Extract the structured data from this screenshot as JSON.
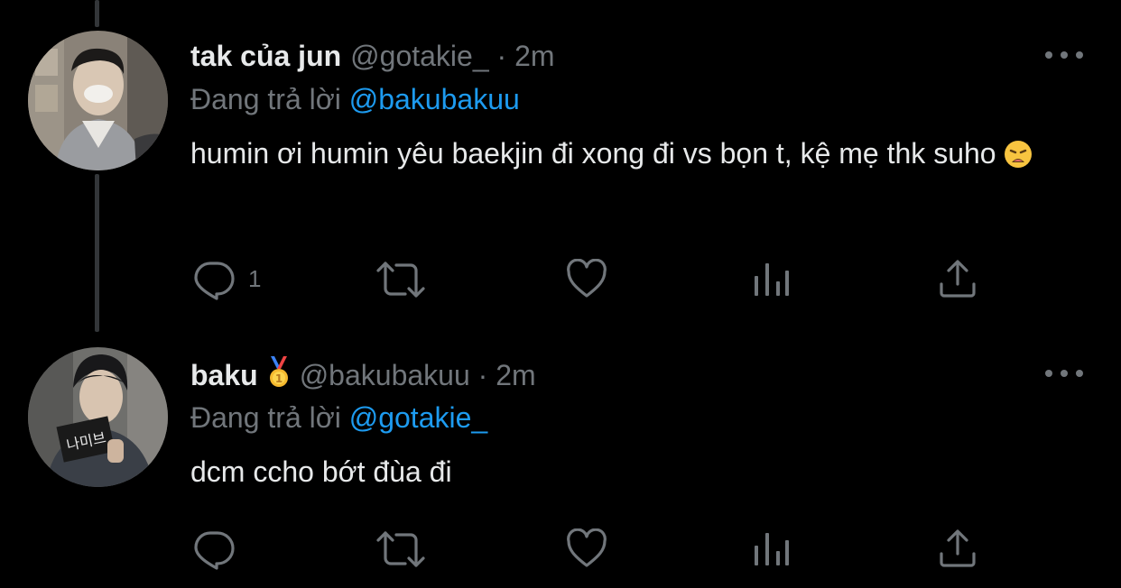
{
  "colors": {
    "background": "#000000",
    "text": "#e7e9ea",
    "muted": "#71767b",
    "link": "#1d9bf0",
    "thread_line": "#333639"
  },
  "tweets": [
    {
      "name": "tak của jun",
      "handle": "@gotakie_",
      "separator": "·",
      "time": "2m",
      "reply_prefix": "Đang trả lời",
      "reply_to": "@bakubakuu",
      "text": "humin ơi humin yêu baekjin đi xong đi vs bọn t, kệ mẹ thk suho",
      "emoji": "weary-face-emoji",
      "actions": {
        "reply_count": "1",
        "retweet_count": "",
        "like_count": ""
      }
    },
    {
      "name": "baku",
      "badge": "first-place-medal-icon",
      "handle": "@bakubakuu",
      "separator": "·",
      "time": "2m",
      "reply_prefix": "Đang trả lời",
      "reply_to": "@gotakie_",
      "text": "dcm ccho bớt đùa đi",
      "avatar_sign_text": "나미브",
      "actions": {
        "reply_count": "",
        "retweet_count": "",
        "like_count": ""
      }
    }
  ],
  "icons": [
    "reply-icon",
    "retweet-icon",
    "like-icon",
    "analytics-icon",
    "share-icon",
    "more-icon"
  ]
}
